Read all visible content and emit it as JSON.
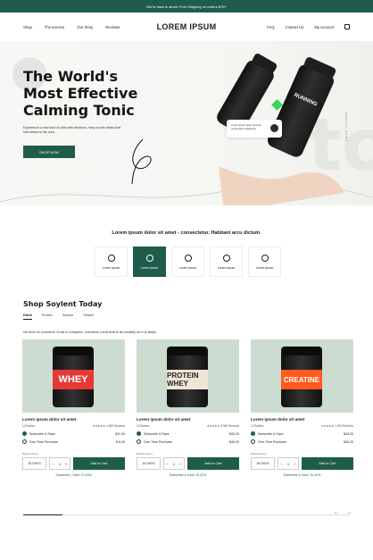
{
  "announcement": "We're back in stock! Free Shipping on orders $79+",
  "nav": {
    "left": [
      "Shop",
      "The science",
      "Our Story",
      "Reviews"
    ],
    "logo": "LOREM IPSUM",
    "right": [
      "FAQ",
      "Contact Us",
      "My Account"
    ]
  },
  "hero": {
    "title_line1": "The World's",
    "title_line2": "Most Effective",
    "title_line3": "Calming Tonic",
    "subtitle": "Experience a new kind of calm with delicious, easy-to-mix drinks that kick stress to the curb.",
    "cta": "SHOP NOW",
    "side_text": "SCROLL DOWN",
    "bottle_label": "RUNNING",
    "badge_text": "Lorem ipsum dolor sit amet consectetur adipiscing",
    "big_letter": "to"
  },
  "intro": "Lorem ipsum dolor sit amet - consectetur. Habitant arcu dictum.",
  "benefits": [
    {
      "label": "Lorem ipsum",
      "active": false
    },
    {
      "label": "Lorem ipsum",
      "active": true
    },
    {
      "label": "Lorem ipsum",
      "active": false
    },
    {
      "label": "Lorem ipsum",
      "active": false
    },
    {
      "label": "Lorem ipsum",
      "active": false
    }
  ],
  "shop": {
    "title": "Shop Soylent Today",
    "tabs": [
      "Drink",
      "Protein",
      "Snacks",
      "Shaker"
    ],
    "tagline": "No time no problem! Grab a complete, nutritious meal that is as healthy as it is tasty!",
    "delivery_label": "Deliver Every",
    "products": [
      {
        "brand": "WHEY",
        "name": "Lorem ipsum dolor sit amet",
        "count": "12 Bottles",
        "reviews": "4,869 Reviews",
        "sub_label": "Subscribe & Save",
        "sub_price": "$11.00",
        "otp_label": "One-Time Purchase",
        "otp_price": "$ 8.00",
        "days": "15 DAYS",
        "add": "Add to Cart",
        "save": "Subscribe | Save 12.43%",
        "color": "#e53935"
      },
      {
        "brand": "PROTEIN WHEY",
        "name": "Lorem ipsum dolor sit amet",
        "count": "12 Bottles",
        "reviews": "5,088 Reviews",
        "sub_label": "Subscribe & Save",
        "sub_price": "$43.00",
        "otp_label": "One-Time Purchase",
        "otp_price": "$45.00",
        "days": "15 DAYS",
        "add": "Add to Cart",
        "save": "Subscribe & Save 10.42%",
        "color": "#efe6d6"
      },
      {
        "brand": "CREATINE",
        "name": "Lorem ipsum dolor sit amet",
        "count": "12 Bottles",
        "reviews": "1,205 Reviews",
        "sub_label": "Subscribe & Save",
        "sub_price": "$43.00",
        "otp_label": "One-Time Purchase",
        "otp_price": "$45.00",
        "days": "15 DAYS",
        "add": "Add to Cart",
        "save": "Subscribe & Save 10.42%",
        "color": "#ff5a1f"
      }
    ]
  },
  "carousel": {
    "progress": 0.12
  }
}
